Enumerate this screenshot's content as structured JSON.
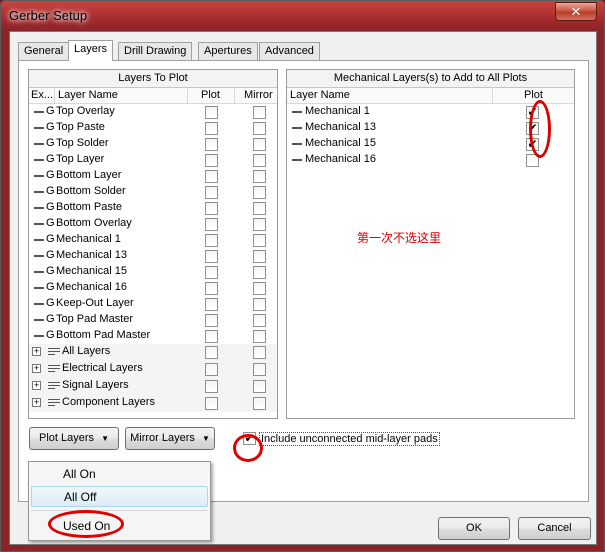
{
  "window": {
    "title": "Gerber Setup",
    "close_glyph": "✕"
  },
  "tabs": [
    "General",
    "Layers",
    "Drill Drawing",
    "Apertures",
    "Advanced"
  ],
  "layers_panel": {
    "title": "Layers To Plot",
    "col_ex": "Ex...",
    "col_name": "Layer Name",
    "col_plot": "Plot",
    "col_mirror": "Mirror",
    "rows": [
      {
        "prefix": "G",
        "name": "Top Overlay"
      },
      {
        "prefix": "G",
        "name": "Top Paste"
      },
      {
        "prefix": "G",
        "name": "Top Solder"
      },
      {
        "prefix": "G",
        "name": "Top Layer"
      },
      {
        "prefix": "G",
        "name": "Bottom Layer"
      },
      {
        "prefix": "G",
        "name": "Bottom Solder"
      },
      {
        "prefix": "G",
        "name": "Bottom Paste"
      },
      {
        "prefix": "G",
        "name": "Bottom Overlay"
      },
      {
        "prefix": "G",
        "name": "Mechanical 1"
      },
      {
        "prefix": "G",
        "name": "Mechanical 13"
      },
      {
        "prefix": "G",
        "name": "Mechanical 15"
      },
      {
        "prefix": "G",
        "name": "Mechanical 16"
      },
      {
        "prefix": "G",
        "name": "Keep-Out Layer"
      },
      {
        "prefix": "G",
        "name": "Top Pad Master"
      },
      {
        "prefix": "G",
        "name": "Bottom Pad Master"
      }
    ],
    "groups": [
      {
        "expander": "+",
        "name": "All Layers"
      },
      {
        "expander": "+",
        "name": "Electrical Layers"
      },
      {
        "expander": "+",
        "name": "Signal Layers"
      },
      {
        "expander": "+",
        "name": "Component Layers"
      }
    ]
  },
  "mech_panel": {
    "title": "Mechanical Layers(s) to Add to All Plots",
    "col_name": "Layer Name",
    "col_plot": "Plot",
    "rows": [
      {
        "name": "Mechanical 1",
        "plot": true
      },
      {
        "name": "Mechanical 13",
        "plot": true
      },
      {
        "name": "Mechanical 15",
        "plot": true
      },
      {
        "name": "Mechanical 16",
        "plot": false
      }
    ]
  },
  "annotation_note": "第一次不选这里",
  "buttons": {
    "plot_layers": "Plot Layers",
    "mirror_layers": "Mirror Layers",
    "dropdown_arrow": "▼",
    "ok": "OK",
    "cancel": "Cancel"
  },
  "include_unconnected": {
    "label": "Include unconnected mid-layer pads",
    "checked": true
  },
  "check_glyph": "✔",
  "dropdown_menu": {
    "items": [
      "All On",
      "All Off",
      "Used On"
    ],
    "highlighted_index": 1
  },
  "colors": {
    "annotation_red": "#e00000",
    "desktop": "#8a2429"
  }
}
